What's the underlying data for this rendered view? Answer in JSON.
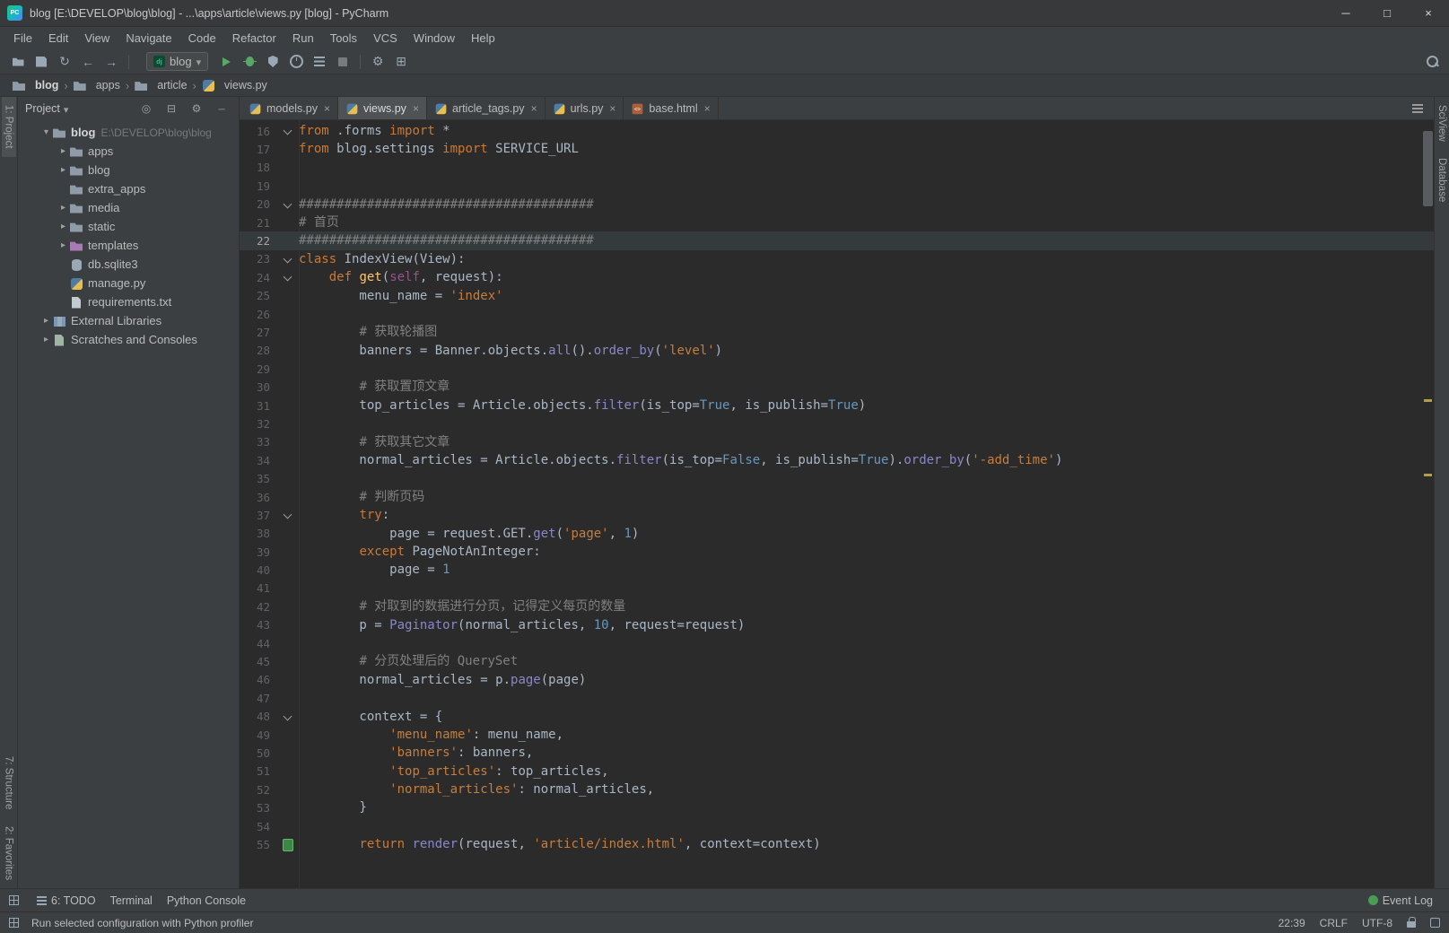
{
  "window": {
    "title": "blog [E:\\DEVELOP\\blog\\blog] - ...\\apps\\article\\views.py [blog] - PyCharm",
    "app_badge": "PC",
    "controls": [
      {
        "name": "minimize",
        "glyph": "─"
      },
      {
        "name": "maximize",
        "glyph": "□"
      },
      {
        "name": "close",
        "glyph": "×"
      }
    ]
  },
  "menu": {
    "items": [
      "File",
      "Edit",
      "View",
      "Navigate",
      "Code",
      "Refactor",
      "Run",
      "Tools",
      "VCS",
      "Window",
      "Help"
    ]
  },
  "toolbar": {
    "file_icons": [
      "open",
      "save-all",
      "synchronize",
      "back",
      "forward"
    ],
    "run_config": {
      "icon_label": "dj",
      "label": "blog"
    },
    "run_icons": [
      "run",
      "debug",
      "coverage",
      "profiler",
      "concurrency",
      "stop"
    ],
    "misc_icons": [
      "wrench",
      "plugins"
    ]
  },
  "breadcrumbs": {
    "separator": "›",
    "items": [
      {
        "label": "blog",
        "icon": "folder",
        "bold": true
      },
      {
        "label": "apps",
        "icon": "folder"
      },
      {
        "label": "article",
        "icon": "folder"
      },
      {
        "label": "views.py",
        "icon": "py"
      }
    ]
  },
  "left_stripe": {
    "top": [
      {
        "label": "1: Project",
        "active": true
      }
    ],
    "bottom": [
      {
        "label": "7: Structure"
      },
      {
        "label": "2: Favorites"
      }
    ]
  },
  "right_stripe": {
    "top": [
      {
        "label": "SciView"
      },
      {
        "label": "Database"
      }
    ]
  },
  "project": {
    "header": {
      "title": "Project",
      "icons": [
        "locate",
        "collapse-all",
        "settings",
        "hide"
      ]
    },
    "tree": [
      {
        "depth": 0,
        "arrow": "open",
        "icon": "folder",
        "label": "blog",
        "sublabel": "E:\\DEVELOP\\blog\\blog",
        "bold": true
      },
      {
        "depth": 1,
        "arrow": "closed",
        "icon": "folder",
        "label": "apps"
      },
      {
        "depth": 1,
        "arrow": "closed",
        "icon": "folder",
        "label": "blog"
      },
      {
        "depth": 1,
        "arrow": "none",
        "icon": "folder",
        "label": "extra_apps"
      },
      {
        "depth": 1,
        "arrow": "closed",
        "icon": "folder",
        "label": "media"
      },
      {
        "depth": 1,
        "arrow": "closed",
        "icon": "folder",
        "label": "static"
      },
      {
        "depth": 1,
        "arrow": "closed",
        "icon": "folder-tpl",
        "label": "templates"
      },
      {
        "depth": 1,
        "arrow": "none",
        "icon": "db",
        "label": "db.sqlite3"
      },
      {
        "depth": 1,
        "arrow": "none",
        "icon": "py",
        "label": "manage.py"
      },
      {
        "depth": 1,
        "arrow": "none",
        "icon": "txt",
        "label": "requirements.txt"
      },
      {
        "depth": 0,
        "arrow": "closed",
        "icon": "lib",
        "label": "External Libraries"
      },
      {
        "depth": 0,
        "arrow": "closed",
        "icon": "scratch",
        "label": "Scratches and Consoles"
      }
    ]
  },
  "editor": {
    "tabs": [
      {
        "label": "models.py",
        "icon": "py"
      },
      {
        "label": "views.py",
        "icon": "py",
        "active": true
      },
      {
        "label": "article_tags.py",
        "icon": "py"
      },
      {
        "label": "urls.py",
        "icon": "py"
      },
      {
        "label": "base.html",
        "icon": "html"
      }
    ],
    "code": {
      "caret_line": 22,
      "lines": [
        {
          "n": 16,
          "f": "v",
          "s": [
            [
              "kw",
              "from"
            ],
            [
              "pl",
              " .forms "
            ],
            [
              "kw",
              "import"
            ],
            [
              "pl",
              " *"
            ]
          ]
        },
        {
          "n": 17,
          "s": [
            [
              "kw",
              "from"
            ],
            [
              "pl",
              " blog.settings "
            ],
            [
              "kw",
              "import"
            ],
            [
              "pl",
              " SERVICE_URL"
            ]
          ]
        },
        {
          "n": 18,
          "s": []
        },
        {
          "n": 19,
          "s": []
        },
        {
          "n": 20,
          "f": "v",
          "s": [
            [
              "cmt",
              "#######################################"
            ]
          ]
        },
        {
          "n": 21,
          "s": [
            [
              "cmt",
              "# 首页"
            ]
          ]
        },
        {
          "n": 22,
          "s": [
            [
              "cmt",
              "#######################################"
            ]
          ]
        },
        {
          "n": 23,
          "f": "v",
          "s": [
            [
              "kw",
              "class"
            ],
            [
              "pl",
              " IndexView(View):"
            ]
          ]
        },
        {
          "n": 24,
          "f": "v",
          "s": [
            [
              "pl",
              "    "
            ],
            [
              "kw",
              "def"
            ],
            [
              "pl",
              " "
            ],
            [
              "fndef",
              "get"
            ],
            [
              "pl",
              "("
            ],
            [
              "slf",
              "self"
            ],
            [
              "pl",
              ", request):"
            ]
          ]
        },
        {
          "n": 25,
          "s": [
            [
              "pl",
              "        menu_name = "
            ],
            [
              "str",
              "'index'"
            ]
          ]
        },
        {
          "n": 26,
          "s": []
        },
        {
          "n": 27,
          "s": [
            [
              "pl",
              "        "
            ],
            [
              "cmt",
              "# 获取轮播图"
            ]
          ]
        },
        {
          "n": 28,
          "s": [
            [
              "pl",
              "        banners = Banner.objects."
            ],
            [
              "fn",
              "all"
            ],
            [
              "pl",
              "()."
            ],
            [
              "fn",
              "order_by"
            ],
            [
              "pl",
              "("
            ],
            [
              "str",
              "'level'"
            ],
            [
              "pl",
              ")"
            ]
          ]
        },
        {
          "n": 29,
          "s": []
        },
        {
          "n": 30,
          "s": [
            [
              "pl",
              "        "
            ],
            [
              "cmt",
              "# 获取置顶文章"
            ]
          ]
        },
        {
          "n": 31,
          "s": [
            [
              "pl",
              "        top_articles = Article.objects."
            ],
            [
              "fn",
              "filter"
            ],
            [
              "pl",
              "(is_top="
            ],
            [
              "num",
              "True"
            ],
            [
              "pl",
              ", is_publish="
            ],
            [
              "num",
              "True"
            ],
            [
              "pl",
              ")"
            ]
          ]
        },
        {
          "n": 32,
          "s": []
        },
        {
          "n": 33,
          "s": [
            [
              "pl",
              "        "
            ],
            [
              "cmt",
              "# 获取其它文章"
            ]
          ]
        },
        {
          "n": 34,
          "s": [
            [
              "pl",
              "        normal_articles = Article.objects."
            ],
            [
              "fn",
              "filter"
            ],
            [
              "pl",
              "(is_top="
            ],
            [
              "num",
              "False"
            ],
            [
              "pl",
              ", is_publish="
            ],
            [
              "num",
              "True"
            ],
            [
              "pl",
              ")."
            ],
            [
              "fn",
              "order_by"
            ],
            [
              "pl",
              "("
            ],
            [
              "str",
              "'-add_time'"
            ],
            [
              "pl",
              ")"
            ]
          ]
        },
        {
          "n": 35,
          "s": []
        },
        {
          "n": 36,
          "s": [
            [
              "pl",
              "        "
            ],
            [
              "cmt",
              "# 判断页码"
            ]
          ]
        },
        {
          "n": 37,
          "f": "v",
          "s": [
            [
              "pl",
              "        "
            ],
            [
              "kw",
              "try"
            ],
            [
              "pl",
              ":"
            ]
          ]
        },
        {
          "n": 38,
          "s": [
            [
              "pl",
              "            page = request.GET."
            ],
            [
              "fn",
              "get"
            ],
            [
              "pl",
              "("
            ],
            [
              "str",
              "'page'"
            ],
            [
              "pl",
              ", "
            ],
            [
              "num",
              "1"
            ],
            [
              "pl",
              ")"
            ]
          ]
        },
        {
          "n": 39,
          "s": [
            [
              "pl",
              "        "
            ],
            [
              "k w",
              "except"
            ],
            [
              "pl",
              " PageNotAnInteger:"
            ]
          ]
        },
        {
          "n": 40,
          "s": [
            [
              "pl",
              "            page = "
            ],
            [
              "num",
              "1"
            ]
          ]
        },
        {
          "n": 41,
          "s": []
        },
        {
          "n": 42,
          "s": [
            [
              "pl",
              "        "
            ],
            [
              "cmt",
              "# 对取到的数据进行分页，记得定义每页的数量"
            ]
          ]
        },
        {
          "n": 43,
          "s": [
            [
              "pl",
              "        p = "
            ],
            [
              "fn",
              "Paginator"
            ],
            [
              "pl",
              "(normal_articles, "
            ],
            [
              "num",
              "10"
            ],
            [
              "pl",
              ", request=request)"
            ]
          ]
        },
        {
          "n": 44,
          "s": []
        },
        {
          "n": 45,
          "s": [
            [
              "pl",
              "        "
            ],
            [
              "cmt",
              "# 分页处理后的 QuerySet"
            ]
          ]
        },
        {
          "n": 46,
          "s": [
            [
              "pl",
              "        normal_articles = p."
            ],
            [
              "fn",
              "page"
            ],
            [
              "pl",
              "(page)"
            ]
          ]
        },
        {
          "n": 47,
          "s": []
        },
        {
          "n": 48,
          "f": "v",
          "s": [
            [
              "pl",
              "        context = {"
            ]
          ]
        },
        {
          "n": 49,
          "s": [
            [
              "pl",
              "            "
            ],
            [
              "str",
              "'menu_name'"
            ],
            [
              "pl",
              ": menu_name,"
            ]
          ]
        },
        {
          "n": 50,
          "s": [
            [
              "pl",
              "            "
            ],
            [
              "str",
              "'banners'"
            ],
            [
              "pl",
              ": banners,"
            ]
          ]
        },
        {
          "n": 51,
          "s": [
            [
              "pl",
              "            "
            ],
            [
              "str",
              "'top_articles'"
            ],
            [
              "pl",
              ": top_articles,"
            ]
          ]
        },
        {
          "n": 52,
          "s": [
            [
              "pl",
              "            "
            ],
            [
              "str",
              "'normal_articles'"
            ],
            [
              "pl",
              ": normal_articles,"
            ]
          ]
        },
        {
          "n": 53,
          "s": [
            [
              "pl",
              "        }"
            ]
          ]
        },
        {
          "n": 54,
          "s": []
        },
        {
          "n": 55,
          "f": "tpl",
          "s": [
            [
              "pl",
              "        "
            ],
            [
              "kw",
              "return"
            ],
            [
              "pl",
              " "
            ],
            [
              "fn",
              "render"
            ],
            [
              "pl",
              "(request, "
            ],
            [
              "str",
              "'article/index.html'"
            ],
            [
              "pl",
              ", context=context)"
            ]
          ]
        }
      ]
    }
  },
  "bottom_bar": {
    "left": [
      {
        "label": "6: TODO",
        "icon": "todo"
      },
      {
        "label": "Terminal"
      },
      {
        "label": "Python Console"
      }
    ],
    "right": [
      {
        "label": "Event Log",
        "icon": "event"
      }
    ]
  },
  "status_bar": {
    "message": "Run selected configuration with Python profiler",
    "position": "22:39",
    "line_ending": "CRLF",
    "encoding": "UTF-8"
  },
  "colors": {
    "bg": "#2b2b2b",
    "panel": "#3c3f41",
    "border": "#323232",
    "fg": "#a9b7c6",
    "kw": "#cc7832",
    "str": "#c77d3c",
    "cmt": "#808080",
    "num": "#6897bb",
    "fn": "#8888c6",
    "fndef": "#ffc66d",
    "self": "#94558d",
    "caret_row": "#353a3d",
    "accent_green": "#59a869"
  }
}
